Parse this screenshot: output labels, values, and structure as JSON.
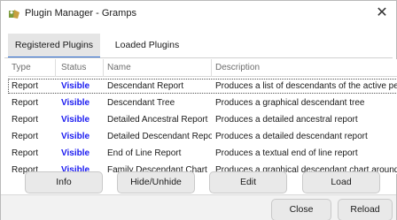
{
  "window": {
    "title": "Plugin Manager - Gramps",
    "close_glyph": "✕"
  },
  "tabs": [
    {
      "label": "Registered Plugins",
      "active": true
    },
    {
      "label": "Loaded Plugins",
      "active": false
    }
  ],
  "table": {
    "headers": [
      "Type",
      "Status",
      "Name",
      "Description"
    ],
    "rows": [
      {
        "type": "Report",
        "status": "Visible",
        "name": "Descendant Report",
        "description": "Produces a list of descendants of the active pers"
      },
      {
        "type": "Report",
        "status": "Visible",
        "name": "Descendant Tree",
        "description": "Produces a graphical descendant tree"
      },
      {
        "type": "Report",
        "status": "Visible",
        "name": "Detailed Ancestral Report",
        "description": "Produces a detailed ancestral report"
      },
      {
        "type": "Report",
        "status": "Visible",
        "name": "Detailed Descendant Report",
        "description": "Produces a detailed descendant report"
      },
      {
        "type": "Report",
        "status": "Visible",
        "name": "End of Line Report",
        "description": "Produces a textual end of line report"
      },
      {
        "type": "Report",
        "status": "Visible",
        "name": "Family Descendant Chart",
        "description": "Produces a graphical descendant chart around a"
      }
    ],
    "status_color": "#1a1af0"
  },
  "buttons": {
    "info": "Info",
    "hide_unhide": "Hide/Unhide",
    "edit": "Edit",
    "load": "Load",
    "close": "Close",
    "reload": "Reload"
  },
  "colors": {
    "tab_accent": "#2f6fd4",
    "status_visible": "#1a1af0"
  }
}
